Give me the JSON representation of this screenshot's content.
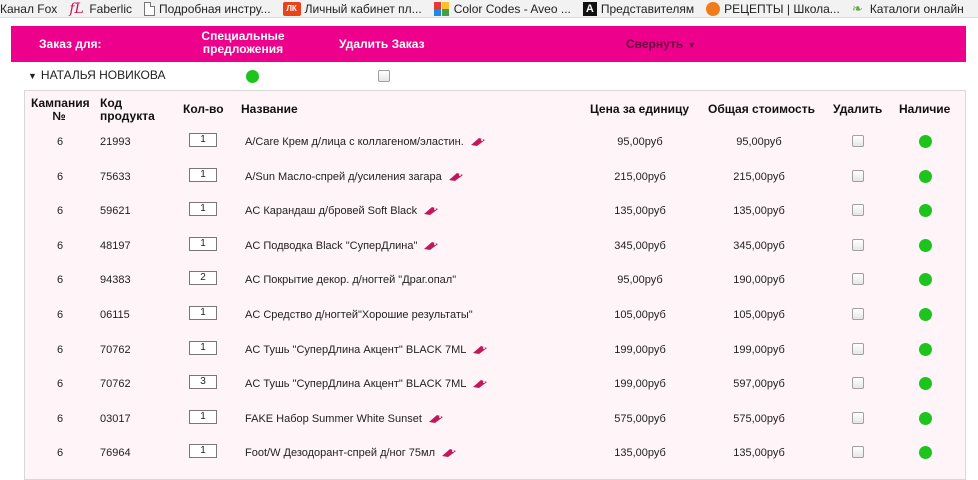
{
  "bookmarks": [
    {
      "label": "Канал Fox",
      "icon": "none-icon"
    },
    {
      "label": "Faberlic",
      "icon": "faberlic-logo-icon"
    },
    {
      "label": "Подробная инстру...",
      "icon": "document-icon"
    },
    {
      "label": "Личный кабинет пл...",
      "icon": "lk-logo-icon"
    },
    {
      "label": "Color Codes - Aveo ...",
      "icon": "color-grid-icon"
    },
    {
      "label": "Представителям",
      "icon": "avon-a-icon"
    },
    {
      "label": "РЕЦЕПТЫ | Школа...",
      "icon": "apple-icon"
    },
    {
      "label": "Каталоги онлайн",
      "icon": "leaf-icon"
    }
  ],
  "header": {
    "order_for": "Заказ для:",
    "special_offers": "Специальные предложения",
    "delete_order": "Удалить Заказ",
    "collapse": "Свернуть",
    "bg_color": "#ec008c"
  },
  "customer": {
    "name": "НАТАЛЬЯ НОВИКОВА",
    "special_offer_status": "available",
    "delete_checked": false
  },
  "table": {
    "columns": {
      "campaign": "Кампания №",
      "code": "Код продукта",
      "qty": "Кол-во",
      "name": "Название",
      "unit_price": "Цена за единицу",
      "total": "Общая стоимость",
      "delete": "Удалить",
      "availability": "Наличие"
    },
    "rows": [
      {
        "campaign": "6",
        "code": "21993",
        "qty": "1",
        "name": "A/Care Крем д/лица с коллагеном/эластин.",
        "tag": true,
        "unit_price": "95,00руб",
        "total": "95,00руб",
        "delete": false,
        "available": true
      },
      {
        "campaign": "6",
        "code": "75633",
        "qty": "1",
        "name": "A/Sun Масло-спрей д/усиления загара",
        "tag": true,
        "unit_price": "215,00руб",
        "total": "215,00руб",
        "delete": false,
        "available": true
      },
      {
        "campaign": "6",
        "code": "59621",
        "qty": "1",
        "name": "AC Карандаш д/бровей Soft Black",
        "tag": true,
        "unit_price": "135,00руб",
        "total": "135,00руб",
        "delete": false,
        "available": true
      },
      {
        "campaign": "6",
        "code": "48197",
        "qty": "1",
        "name": "AC Подводка Black \"СуперДлина\"",
        "tag": true,
        "unit_price": "345,00руб",
        "total": "345,00руб",
        "delete": false,
        "available": true
      },
      {
        "campaign": "6",
        "code": "94383",
        "qty": "2",
        "name": "AC Покрытие декор. д/ногтей \"Драг.опал\"",
        "tag": false,
        "unit_price": "95,00руб",
        "total": "190,00руб",
        "delete": false,
        "available": true
      },
      {
        "campaign": "6",
        "code": "06115",
        "qty": "1",
        "name": "AC Средство д/ногтей\"Хорошие результаты\"",
        "tag": false,
        "unit_price": "105,00руб",
        "total": "105,00руб",
        "delete": false,
        "available": true
      },
      {
        "campaign": "6",
        "code": "70762",
        "qty": "1",
        "name": "AC Тушь \"СуперДлина Акцент\" BLACK 7ML",
        "tag": true,
        "unit_price": "199,00руб",
        "total": "199,00руб",
        "delete": false,
        "available": true
      },
      {
        "campaign": "6",
        "code": "70762",
        "qty": "3",
        "name": "AC Тушь \"СуперДлина Акцент\" BLACK 7ML",
        "tag": true,
        "unit_price": "199,00руб",
        "total": "597,00руб",
        "delete": false,
        "available": true
      },
      {
        "campaign": "6",
        "code": "03017",
        "qty": "1",
        "name": "FAKE Набор Summer White Sunset",
        "tag": true,
        "unit_price": "575,00руб",
        "total": "575,00руб",
        "delete": false,
        "available": true
      },
      {
        "campaign": "6",
        "code": "76964",
        "qty": "1",
        "name": "Foot/W Дезодорант-спрей д/ног 75мл",
        "tag": true,
        "unit_price": "135,00руб",
        "total": "135,00руб",
        "delete": false,
        "available": true
      }
    ]
  },
  "colors": {
    "available": "#1ec41e",
    "tag": "#c2185b",
    "panel_bg": "#fff5f8"
  }
}
